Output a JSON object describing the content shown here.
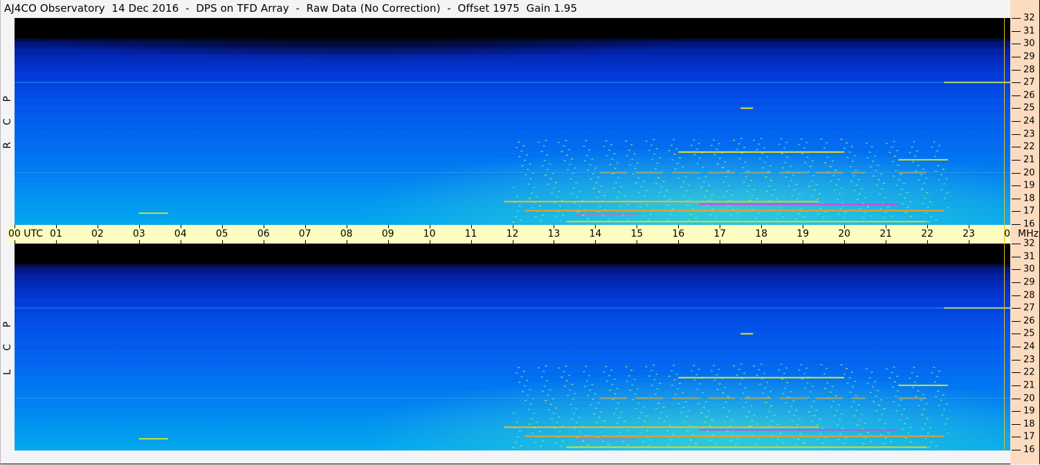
{
  "title": "AJ4CO Observatory  14 Dec 2016  -  DPS on TFD Array  -  Raw Data (No Correction)  -  Offset 1975  Gain 1.95",
  "panels": [
    {
      "label_letters": [
        "R",
        "C",
        "P"
      ]
    },
    {
      "label_letters": [
        "L",
        "C",
        "P"
      ]
    }
  ],
  "x_axis": {
    "utc_label": "UTC",
    "unit_label": "MHz"
  },
  "chart_data": {
    "type": "heatmap",
    "title": "AJ4CO Observatory  14 Dec 2016  -  DPS on TFD Array  -  Raw Data (No Correction)  -  Offset 1975  Gain 1.95",
    "xlabel": "UTC",
    "ylabel": "MHz",
    "xlim": [
      0,
      24
    ],
    "ylim": [
      16,
      32
    ],
    "x_ticks": [
      "00",
      "01",
      "02",
      "03",
      "04",
      "05",
      "06",
      "07",
      "08",
      "09",
      "10",
      "11",
      "12",
      "13",
      "14",
      "15",
      "16",
      "17",
      "18",
      "19",
      "20",
      "21",
      "22",
      "23",
      "00"
    ],
    "y_ticks": [
      32,
      31,
      30,
      29,
      28,
      27,
      26,
      25,
      24,
      23,
      22,
      21,
      20,
      19,
      18,
      17,
      16
    ],
    "series": [
      {
        "name": "RCP"
      },
      {
        "name": "LCP"
      }
    ],
    "signals": [
      {
        "freq": 21.6,
        "start": 16.0,
        "end": 20.0,
        "color": "#e8e020"
      },
      {
        "freq": 21.0,
        "start": 21.3,
        "end": 22.5,
        "color": "#d8e020"
      },
      {
        "freq": 20.0,
        "start": 14.1,
        "end": 20.5,
        "color": "#f0a020"
      },
      {
        "freq": 20.0,
        "start": 21.3,
        "end": 22.0,
        "color": "#f0a020"
      },
      {
        "freq": 25.0,
        "start": 17.5,
        "end": 17.8,
        "color": "#f0e020"
      },
      {
        "freq": 27.0,
        "start": 22.4,
        "end": 24.0,
        "color": "#e8e020"
      },
      {
        "freq": 17.75,
        "start": 11.8,
        "end": 19.4,
        "color": "#f0c020"
      },
      {
        "freq": 17.55,
        "start": 16.5,
        "end": 21.3,
        "color": "#e040e0"
      },
      {
        "freq": 17.05,
        "start": 12.3,
        "end": 22.4,
        "color": "#f0a020"
      },
      {
        "freq": 16.85,
        "start": 3.0,
        "end": 3.7,
        "color": "#d0e030"
      },
      {
        "freq": 16.8,
        "start": 13.5,
        "end": 15.0,
        "color": "#e060c0"
      },
      {
        "freq": 16.2,
        "start": 13.3,
        "end": 22.0,
        "color": "#d8d830"
      },
      {
        "freq": 27.0,
        "start": 0.0,
        "end": 24.0,
        "color": "#40c0f0"
      },
      {
        "freq": 20.0,
        "start": 0.0,
        "end": 24.0,
        "color": "#30a8e8"
      }
    ],
    "colors": {
      "background": "#000000",
      "low": "#0040e0",
      "mid": "#00a8ee",
      "high": "#f0e020",
      "peak": "#e040e0"
    }
  }
}
